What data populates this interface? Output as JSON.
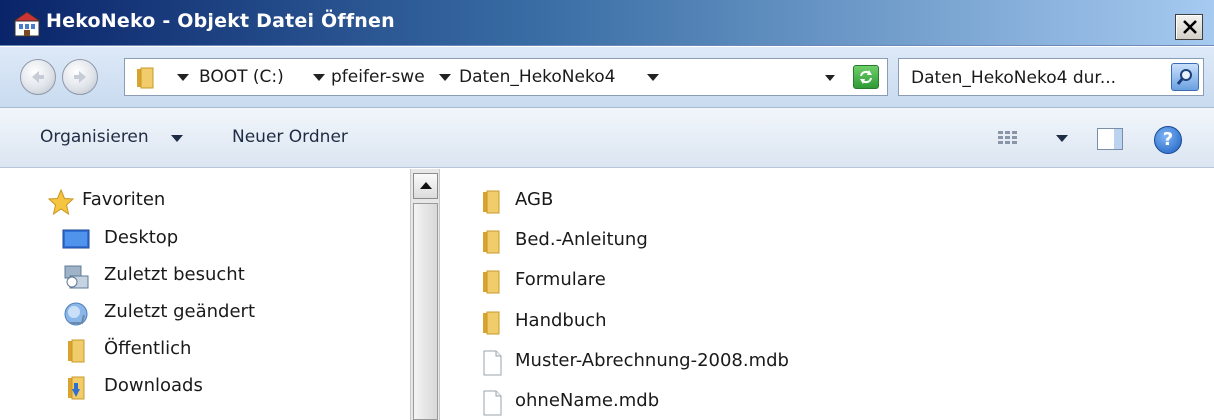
{
  "window": {
    "title": "HekoNeko - Objekt Datei Öffnen",
    "close_label": "✕"
  },
  "address_bar": {
    "crumbs": [
      "BOOT (C:)",
      "pfeifer-swe",
      "Daten_HekoNeko4"
    ]
  },
  "search": {
    "placeholder": "Daten_HekoNeko4 dur..."
  },
  "toolbar": {
    "organize_label": "Organisieren",
    "new_folder_label": "Neuer Ordner",
    "help_label": "?"
  },
  "navigation": {
    "favorites_label": "Favoriten",
    "items": [
      {
        "label": "Desktop",
        "icon": "desktop-icon"
      },
      {
        "label": "Zuletzt besucht",
        "icon": "recent-places-icon"
      },
      {
        "label": "Zuletzt geändert",
        "icon": "recently-changed-icon"
      },
      {
        "label": "Öffentlich",
        "icon": "folder-icon"
      },
      {
        "label": "Downloads",
        "icon": "downloads-folder-icon"
      }
    ]
  },
  "files": [
    {
      "name": "AGB",
      "type": "folder"
    },
    {
      "name": "Bed.-Anleitung",
      "type": "folder"
    },
    {
      "name": "Formulare",
      "type": "folder"
    },
    {
      "name": "Handbuch",
      "type": "folder"
    },
    {
      "name": "Muster-Abrechnung-2008.mdb",
      "type": "file"
    },
    {
      "name": "ohneName.mdb",
      "type": "file"
    }
  ],
  "colors": {
    "title_gradient_start": "#0a246a",
    "title_gradient_end": "#a6caf0",
    "folder_yellow": "#e8b84a",
    "toolbar_bg": "#dbe5f1"
  }
}
